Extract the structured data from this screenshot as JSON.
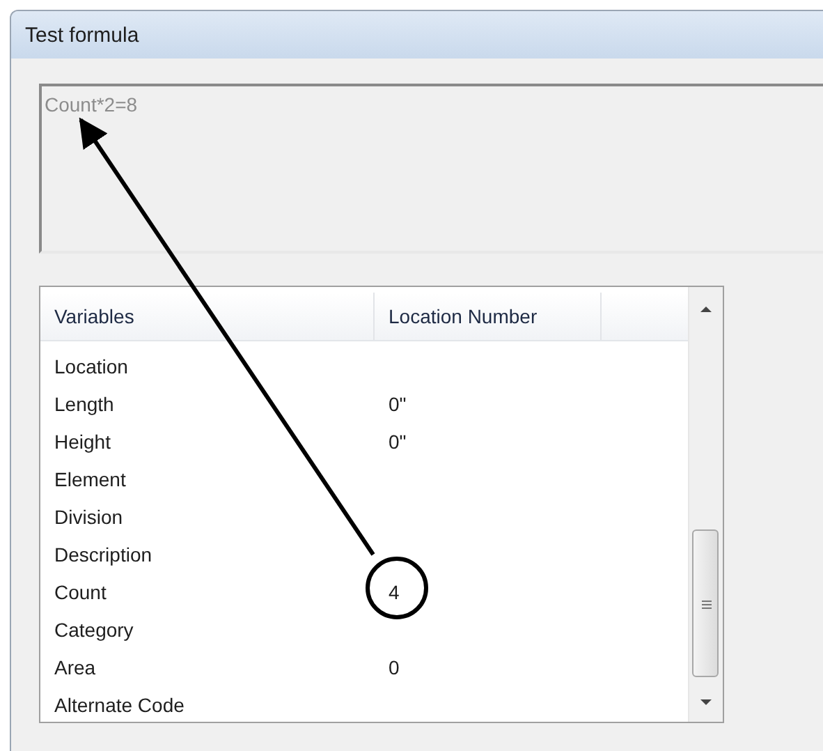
{
  "window": {
    "title": "Test formula"
  },
  "formula": {
    "value": "Count*2=8"
  },
  "table": {
    "columns": [
      "Variables",
      "Location Number"
    ],
    "rows": [
      {
        "name": "Location",
        "value": ""
      },
      {
        "name": "Length",
        "value": "0\""
      },
      {
        "name": "Height",
        "value": "0\""
      },
      {
        "name": "Element",
        "value": ""
      },
      {
        "name": "Division",
        "value": ""
      },
      {
        "name": "Description",
        "value": ""
      },
      {
        "name": "Count",
        "value": "4"
      },
      {
        "name": "Category",
        "value": ""
      },
      {
        "name": "Area",
        "value": "0"
      },
      {
        "name": "Alternate Code",
        "value": ""
      }
    ]
  }
}
